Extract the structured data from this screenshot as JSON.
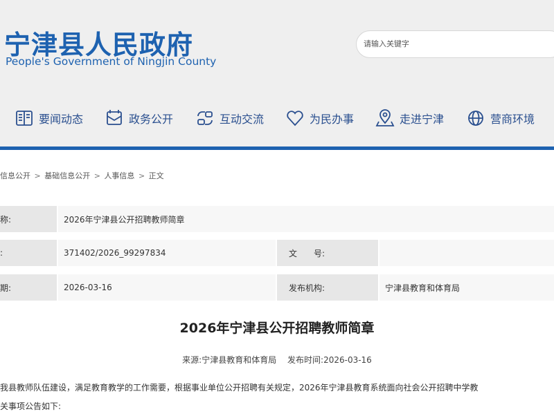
{
  "header": {
    "title": "宁津县人民政府",
    "subtitle": "People's Government of Ningjin County",
    "search_placeholder": "请输入关键字"
  },
  "nav": {
    "items": [
      {
        "label": "要闻动态",
        "icon": "newspaper-icon"
      },
      {
        "label": "政务公开",
        "icon": "document-icon"
      },
      {
        "label": "互动交流",
        "icon": "interaction-icon"
      },
      {
        "label": "为民办事",
        "icon": "heart-icon"
      },
      {
        "label": "走进宁津",
        "icon": "location-icon"
      },
      {
        "label": "营商环境",
        "icon": "globe-icon"
      }
    ],
    "accent": "#1e62b0"
  },
  "breadcrumb": {
    "items": [
      "信息公开",
      "基础信息公开",
      "人事信息",
      "正文"
    ],
    "separator": ">"
  },
  "info": {
    "row1": {
      "label": "称:",
      "value": "2026年宁津县公开招聘教师简章"
    },
    "row2": {
      "label": ":",
      "value": "371402/2026_99297834",
      "label2": "文　　号:",
      "value2": ""
    },
    "row3": {
      "label": "期:",
      "value": "2026-03-16",
      "label2": "发布机构:",
      "value2": "宁津县教育和体育局"
    }
  },
  "article": {
    "title": "2026年宁津县公开招聘教师简章",
    "source": "来源:宁津县教育和体育局",
    "publish_time": "发布时间:2026-03-16",
    "line1": "我县教师队伍建设，满足教育教学的工作需要，根据事业单位公开招聘有关规定，2026年宁津县教育系统面向社会公开招聘中学教",
    "line2": "关事项公告如下:"
  }
}
